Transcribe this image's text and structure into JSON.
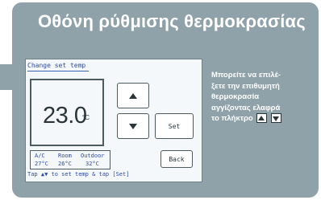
{
  "title": "Οθόνη ρύθμισης θερμοκρασίας",
  "screen": {
    "title": "Change set temp",
    "temperature": "23.0",
    "temperature_unit": "°C",
    "buttons": {
      "up_icon": "triangle-up-icon",
      "down_icon": "triangle-down-icon",
      "set_label": "Set",
      "back_label": "Back"
    },
    "info": {
      "ac_label": "A/C",
      "ac_value": "27°C",
      "room_label": "Room",
      "room_value": "26°C",
      "outdoor_label": "Outdoor",
      "outdoor_value": "32°C"
    },
    "hint": "Tap ▲▼ to set temp & tap [Set]"
  },
  "side_text": {
    "lines": [
      "Μπορείτε να επιλέ-",
      "ξετε την επιθυμητή",
      "θερμοκρασία",
      "αγγίζοντας ελαφρά",
      "το πλήκτρο"
    ]
  },
  "colors": {
    "panel": "#8fa1a9",
    "screen_bg": "#f4f8fb",
    "screen_text": "#2b4aa8",
    "title_text": "#ffffff"
  }
}
